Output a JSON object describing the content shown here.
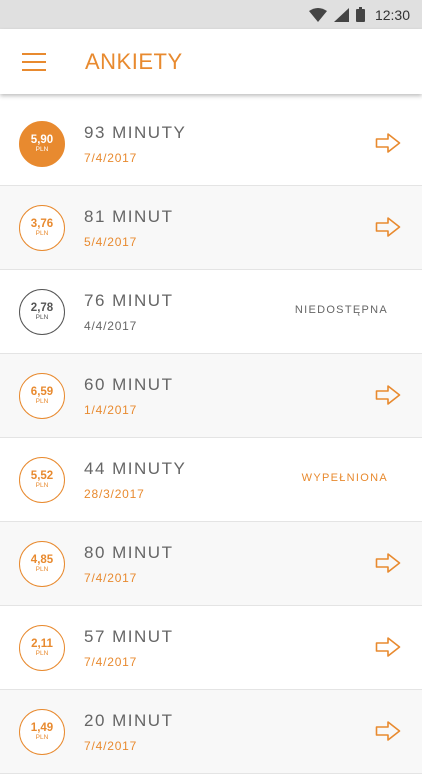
{
  "status_bar": {
    "time": "12:30"
  },
  "app_bar": {
    "title": "ANKIETY"
  },
  "colors": {
    "accent": "#e88a2f",
    "muted": "#555555"
  },
  "surveys": [
    {
      "price": "5,90",
      "currency": "PLN",
      "title": "93 MINUTY",
      "date": "7/4/2017"
    },
    {
      "price": "3,76",
      "currency": "PLN",
      "title": "81 MINUT",
      "date": "5/4/2017"
    },
    {
      "price": "2,78",
      "currency": "PLN",
      "title": "76 MINUT",
      "date": "4/4/2017",
      "status": "NIEDOSTĘPNA"
    },
    {
      "price": "6,59",
      "currency": "PLN",
      "title": "60 MINUT",
      "date": "1/4/2017"
    },
    {
      "price": "5,52",
      "currency": "PLN",
      "title": "44 MINUTY",
      "date": "28/3/2017",
      "status": "WYPEŁNIONA"
    },
    {
      "price": "4,85",
      "currency": "PLN",
      "title": "80 MINUT",
      "date": "7/4/2017"
    },
    {
      "price": "2,11",
      "currency": "PLN",
      "title": "57 MINUT",
      "date": "7/4/2017"
    },
    {
      "price": "1,49",
      "currency": "PLN",
      "title": "20 MINUT",
      "date": "7/4/2017"
    }
  ]
}
